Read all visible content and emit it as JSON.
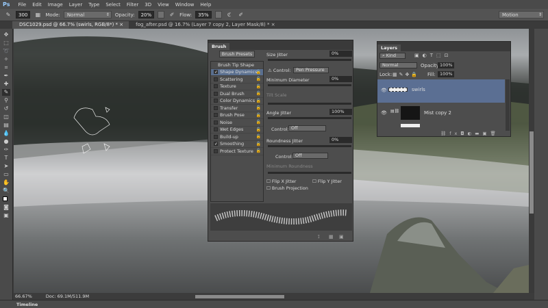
{
  "menu": {
    "logo": "Ps",
    "items": [
      "File",
      "Edit",
      "Image",
      "Layer",
      "Type",
      "Select",
      "Filter",
      "3D",
      "View",
      "Window",
      "Help"
    ]
  },
  "options": {
    "brush_size": "300",
    "mode_label": "Mode:",
    "mode": "Normal",
    "opacity_label": "Opacity:",
    "opacity": "20%",
    "flow_label": "Flow:",
    "flow": "35%",
    "workspace": "Motion"
  },
  "tabs": [
    {
      "label": "DSC1029.psd @ 66.7% (swirls, RGB/8*) *",
      "close": "×"
    },
    {
      "label": "fog_after.psd @ 16.7% (Layer 7 copy 2, Layer Mask/8) *",
      "close": "×"
    }
  ],
  "status": {
    "zoom": "66.67%",
    "doc": "Doc: 69.1M/511.9M"
  },
  "timeline": "Timeline",
  "brush": {
    "title": "Brush",
    "presets_button": "Brush Presets",
    "tip_shape": "Brush Tip Shape",
    "options": [
      {
        "label": "Shape Dynamics",
        "checked": true
      },
      {
        "label": "Scattering",
        "checked": false
      },
      {
        "label": "Texture",
        "checked": false
      },
      {
        "label": "Dual Brush",
        "checked": false
      },
      {
        "label": "Color Dynamics",
        "checked": false
      },
      {
        "label": "Transfer",
        "checked": false
      },
      {
        "label": "Brush Pose",
        "checked": false
      },
      {
        "label": "Noise",
        "checked": false
      },
      {
        "label": "Wet Edges",
        "checked": false
      },
      {
        "label": "Build-up",
        "checked": false
      },
      {
        "label": "Smoothing",
        "checked": true
      },
      {
        "label": "Protect Texture",
        "checked": false
      }
    ],
    "size_jitter": {
      "label": "Size Jitter",
      "value": "0%"
    },
    "control_label": "Control:",
    "control1": "Pen Pressure",
    "min_diameter": {
      "label": "Minimum Diameter",
      "value": "0%"
    },
    "tilt_scale": "Tilt Scale",
    "angle_jitter": {
      "label": "Angle Jitter",
      "value": "100%"
    },
    "control2": "Off",
    "roundness_jitter": {
      "label": "Roundness Jitter",
      "value": "0%"
    },
    "control3": "Off",
    "min_roundness": "Minimum Roundness",
    "flip_x": "Flip X Jitter",
    "flip_y": "Flip Y Jitter",
    "projection": "Brush Projection"
  },
  "layers": {
    "title": "Layers",
    "kind": "Kind",
    "blend": "Normal",
    "opacity_label": "Opacity:",
    "opacity": "100%",
    "lock_label": "Lock:",
    "fill_label": "Fill:",
    "fill": "100%",
    "items": [
      {
        "name": "swirls",
        "selected": true
      },
      {
        "name": "Mist copy 2",
        "selected": false
      }
    ]
  }
}
